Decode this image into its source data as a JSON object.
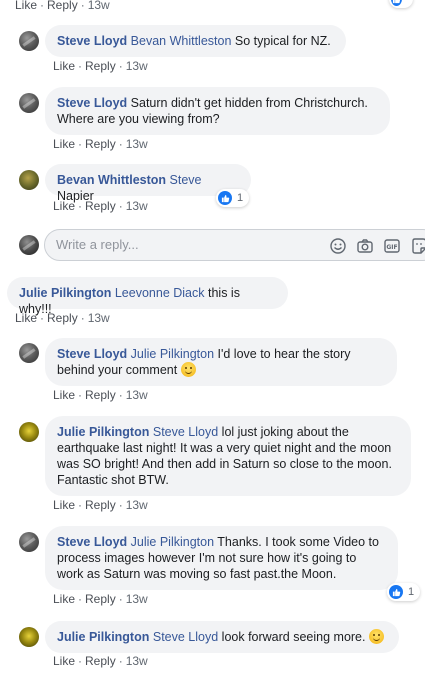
{
  "action_labels": {
    "like": "Like",
    "reply": "Reply"
  },
  "top_actions": {
    "time": "13w"
  },
  "comments": [
    {
      "author": "Steve Lloyd",
      "tag": "Bevan Whittleston",
      "text": " So typical for NZ.",
      "time": "13w"
    },
    {
      "author": "Steve Lloyd",
      "tag": "",
      "text": "Saturn didn't get hidden from Christchurch. Where are you viewing from?",
      "time": "13w"
    },
    {
      "author": "Bevan Whittleston",
      "tag": "Steve",
      "text": " Napier",
      "time": "13w",
      "reactions": "1"
    },
    {
      "author": "Julie Pilkington",
      "tag": "Leevonne Diack",
      "text": " this is why!!!",
      "time": "13w"
    },
    {
      "author": "Steve Lloyd",
      "tag": "Julie Pilkington",
      "text": " I'd love to hear the story behind your comment",
      "time": "13w"
    },
    {
      "author": "Julie Pilkington",
      "tag": "Steve Lloyd",
      "text": " lol just joking about the earthquake last night! It was a very quiet night and the moon was SO bright! And then add in Saturn so close to the moon. Fantastic shot BTW.",
      "time": "13w"
    },
    {
      "author": "Steve Lloyd",
      "tag": "Julie Pilkington",
      "text": " Thanks. I took some Video to process images however I'm not sure how it's going to work as Saturn was moving so fast past.the Moon.",
      "time": "13w",
      "reactions": "1"
    },
    {
      "author": "Julie Pilkington",
      "tag": "Steve Lloyd",
      "text": " look forward seeing more.",
      "time": "13w"
    }
  ],
  "reply_box": {
    "placeholder": "Write a reply..."
  },
  "icons": {
    "reply_box": [
      "emoji-icon",
      "camera-icon",
      "gif-icon",
      "sticker-icon"
    ],
    "reaction": "like-icon",
    "inline_emoji": "smiley-emoji-icon"
  },
  "colors": {
    "name": "#385898",
    "bubble": "#f2f3f5",
    "meta": "#606770",
    "like_blue": "#1877f2"
  }
}
